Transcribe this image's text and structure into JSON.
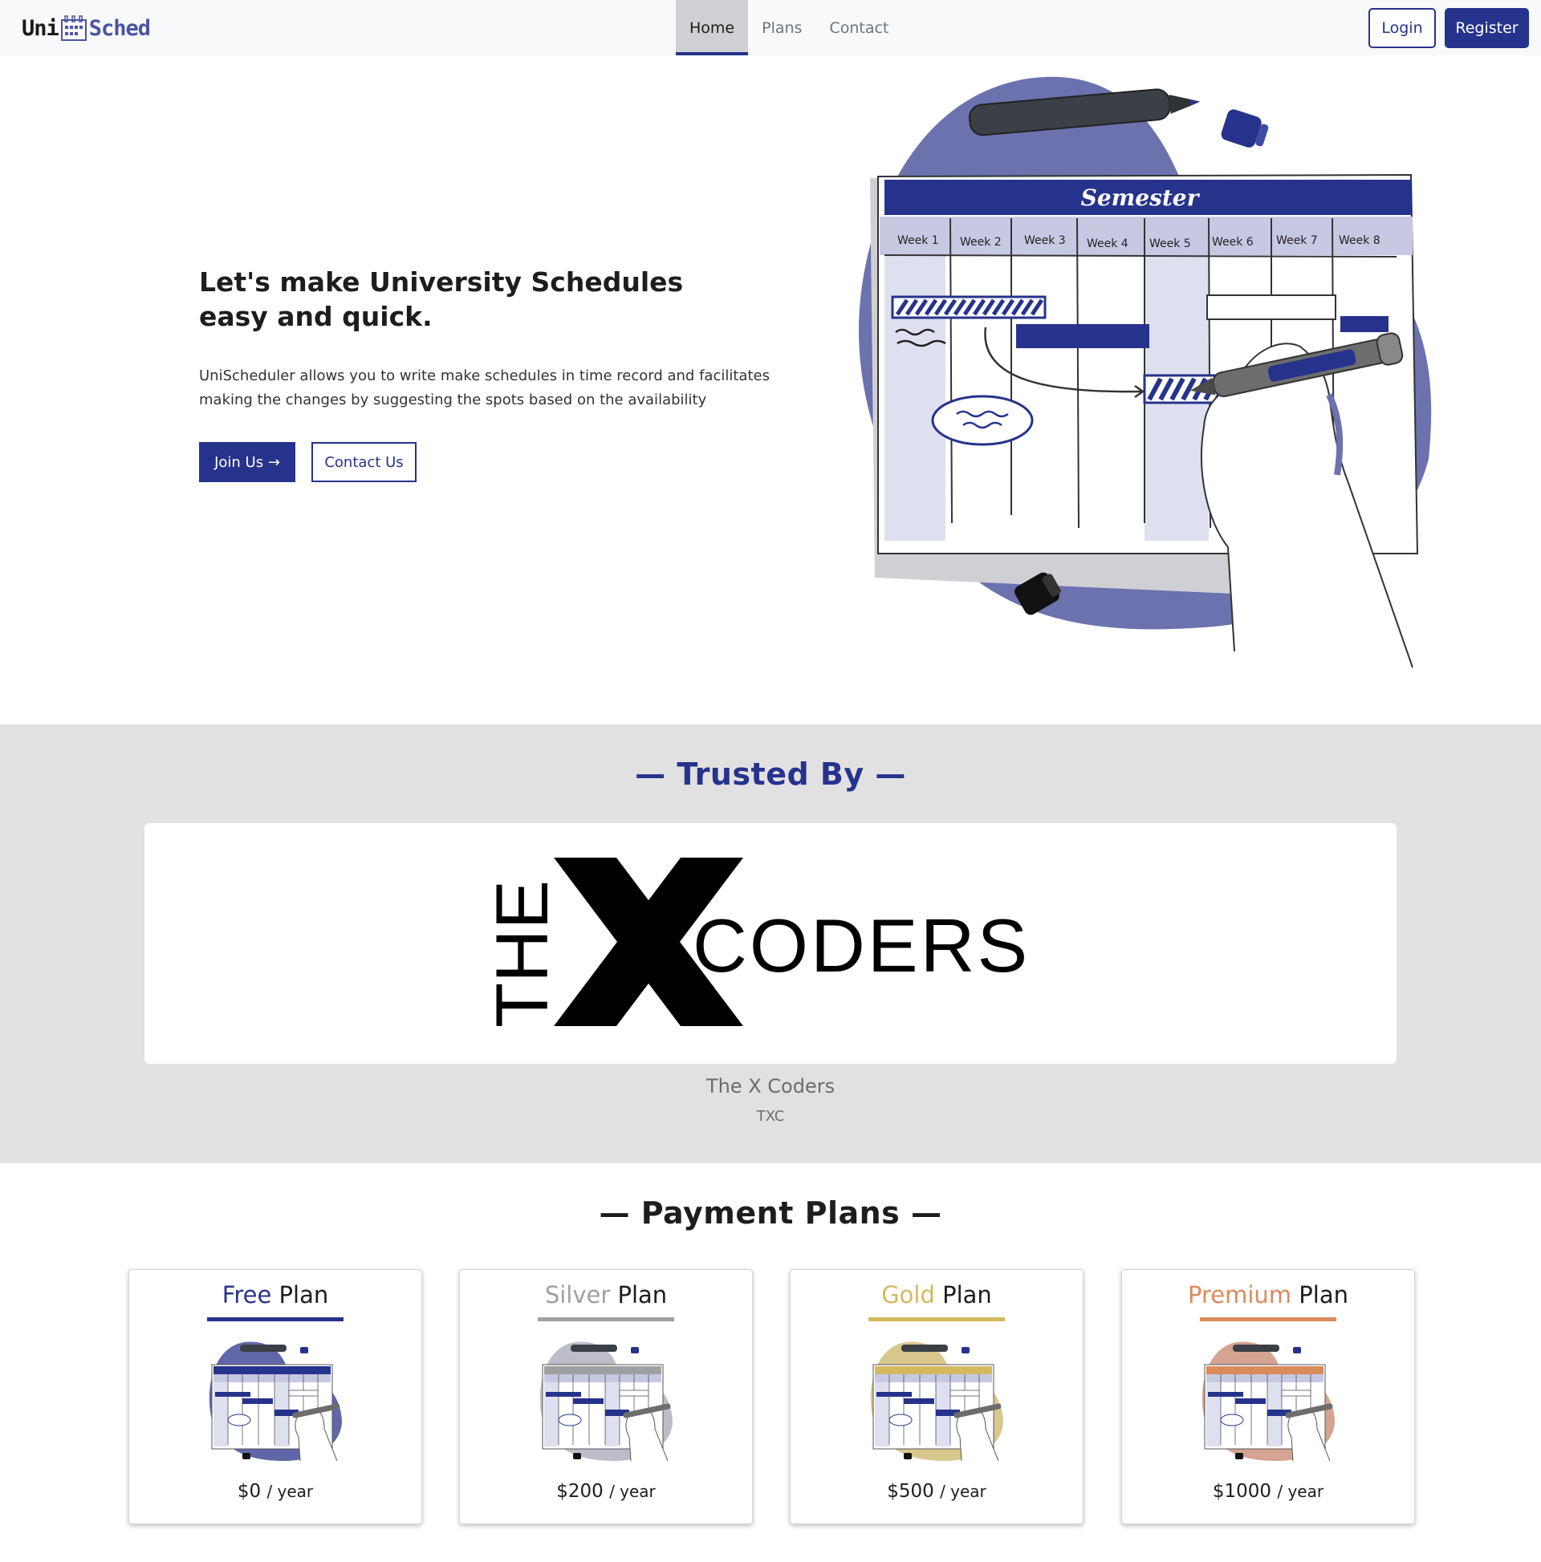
{
  "navbar": {
    "brand_left": "Uni",
    "brand_right": "Sched",
    "links": [
      {
        "label": "Home",
        "active": true
      },
      {
        "label": "Plans",
        "active": false
      },
      {
        "label": "Contact",
        "active": false
      }
    ],
    "login_label": "Login",
    "register_label": "Register"
  },
  "hero": {
    "title_line1": "Let's make University Schedules",
    "title_line2": "easy and quick.",
    "description": "UniScheduler allows you to write make schedules in time record and facilitates making the changes by suggesting the spots based on the availability",
    "join_label": "Join Us →",
    "contact_label": "Contact Us",
    "illustration": {
      "title": "Semester",
      "weeks": [
        "Week 1",
        "Week 2",
        "Week 3",
        "Week 4",
        "Week 5",
        "Week 6",
        "Week 7",
        "Week 8"
      ]
    }
  },
  "trusted": {
    "title": "— Trusted By —",
    "logo": {
      "the": "THE",
      "x": "X",
      "coders": "CODERS"
    },
    "partner_name": "The X Coders",
    "partner_abbr": "TXC"
  },
  "plans": {
    "title": "— Payment Plans —",
    "items": [
      {
        "tier": "Free",
        "word": "Plan",
        "price": "$0",
        "period": "/ year",
        "color": "#26338c",
        "blob": "#5f67a8"
      },
      {
        "tier": "Silver",
        "word": "Plan",
        "price": "$200",
        "period": "/ year",
        "color": "#a0a0a0",
        "blob": "#bdbdc9"
      },
      {
        "tier": "Gold",
        "word": "Plan",
        "price": "$500",
        "period": "/ year",
        "color": "#d4b85e",
        "blob": "#d8c88e"
      },
      {
        "tier": "Premium",
        "word": "Plan",
        "price": "$1000",
        "period": "/ year",
        "color": "#db8a5a",
        "blob": "#d4a391"
      }
    ]
  },
  "colors": {
    "primary": "#26338c",
    "accent": "#5f67a8",
    "section_bg": "#e1e1e1"
  }
}
